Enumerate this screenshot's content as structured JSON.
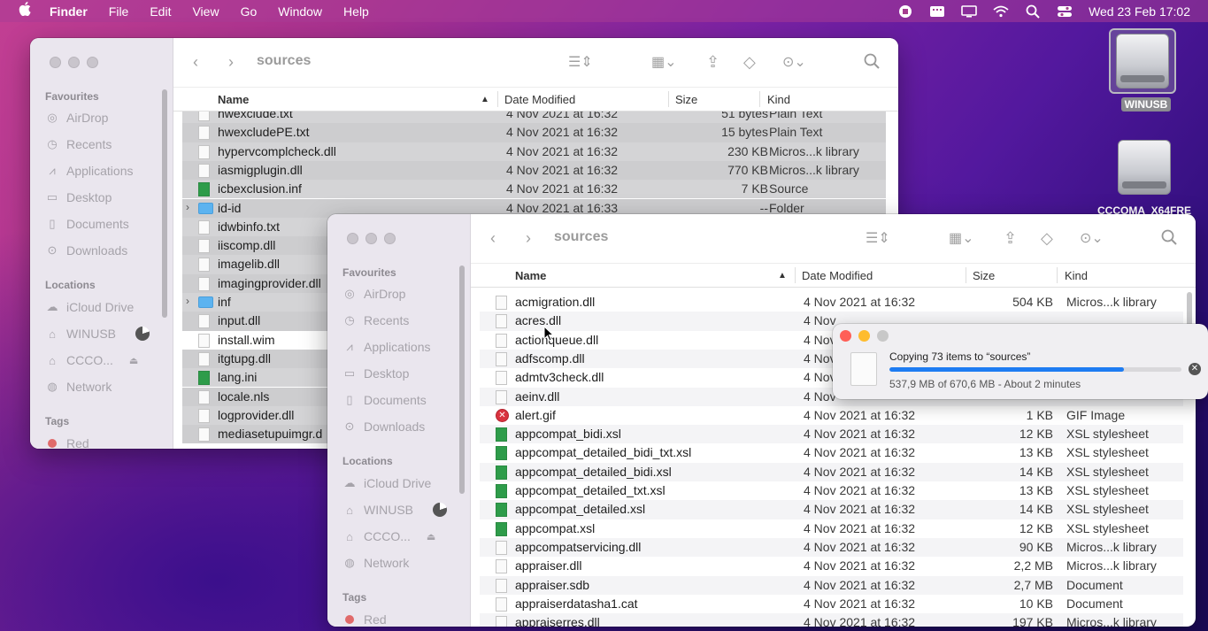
{
  "menubar": {
    "apple": "",
    "menus": [
      "Finder",
      "File",
      "Edit",
      "View",
      "Go",
      "Window",
      "Help"
    ],
    "clock": "Wed 23 Feb  17:02"
  },
  "desktop": {
    "drives": [
      {
        "label": "WINUSB",
        "selected": true
      },
      {
        "label": "CCCOMA_X64FRE",
        "selected": false
      }
    ]
  },
  "back_window": {
    "title": "sources",
    "sidebar": {
      "favourites_header": "Favourites",
      "favourites": [
        "AirDrop",
        "Recents",
        "Applications",
        "Desktop",
        "Documents",
        "Downloads"
      ],
      "locations_header": "Locations",
      "locations": [
        "iCloud Drive",
        "WINUSB",
        "CCCO...",
        "Network"
      ],
      "tags_header": "Tags",
      "tags": [
        "Red"
      ]
    },
    "columns": {
      "name": "Name",
      "date": "Date Modified",
      "size": "Size",
      "kind": "Kind"
    },
    "rows": [
      {
        "name": "hwexclude.txt",
        "date": "4 Nov 2021 at 16:32",
        "size": "51 bytes",
        "kind": "Plain Text"
      },
      {
        "name": "hwexcludePE.txt",
        "date": "4 Nov 2021 at 16:32",
        "size": "15 bytes",
        "kind": "Plain Text"
      },
      {
        "name": "hypervcomplcheck.dll",
        "date": "4 Nov 2021 at 16:32",
        "size": "230 KB",
        "kind": "Micros...k library"
      },
      {
        "name": "iasmigplugin.dll",
        "date": "4 Nov 2021 at 16:32",
        "size": "770 KB",
        "kind": "Micros...k library"
      },
      {
        "name": "icbexclusion.inf",
        "date": "4 Nov 2021 at 16:32",
        "size": "7 KB",
        "kind": "Source"
      },
      {
        "name": "id-id",
        "date": "4 Nov 2021 at 16:33",
        "size": "--",
        "kind": "Folder"
      },
      {
        "name": "idwbinfo.txt",
        "date": "",
        "size": "",
        "kind": ""
      },
      {
        "name": "iiscomp.dll",
        "date": "",
        "size": "",
        "kind": ""
      },
      {
        "name": "imagelib.dll",
        "date": "",
        "size": "",
        "kind": ""
      },
      {
        "name": "imagingprovider.dll",
        "date": "",
        "size": "",
        "kind": ""
      },
      {
        "name": "inf",
        "date": "",
        "size": "",
        "kind": ""
      },
      {
        "name": "input.dll",
        "date": "",
        "size": "",
        "kind": ""
      },
      {
        "name": "install.wim",
        "date": "",
        "size": "",
        "kind": ""
      },
      {
        "name": "itgtupg.dll",
        "date": "",
        "size": "",
        "kind": ""
      },
      {
        "name": "lang.ini",
        "date": "",
        "size": "",
        "kind": ""
      },
      {
        "name": "locale.nls",
        "date": "",
        "size": "",
        "kind": ""
      },
      {
        "name": "logprovider.dll",
        "date": "",
        "size": "",
        "kind": ""
      },
      {
        "name": "mediasetupuimgr.d",
        "date": "",
        "size": "",
        "kind": ""
      }
    ]
  },
  "front_window": {
    "title": "sources",
    "sidebar": {
      "favourites_header": "Favourites",
      "favourites": [
        "AirDrop",
        "Recents",
        "Applications",
        "Desktop",
        "Documents",
        "Downloads"
      ],
      "locations_header": "Locations",
      "locations": [
        "iCloud Drive",
        "WINUSB",
        "CCCO...",
        "Network"
      ],
      "tags_header": "Tags",
      "tags": [
        "Red"
      ]
    },
    "columns": {
      "name": "Name",
      "date": "Date Modified",
      "size": "Size",
      "kind": "Kind"
    },
    "rows": [
      {
        "name": "acmigration.dll",
        "date": "4 Nov 2021 at 16:32",
        "size": "504 KB",
        "kind": "Micros...k library"
      },
      {
        "name": "acres.dll",
        "date": "4 Nov",
        "size": "",
        "kind": ""
      },
      {
        "name": "actionqueue.dll",
        "date": "4 Nov",
        "size": "",
        "kind": ""
      },
      {
        "name": "adfscomp.dll",
        "date": "4 Nov",
        "size": "",
        "kind": ""
      },
      {
        "name": "admtv3check.dll",
        "date": "4 Nov",
        "size": "",
        "kind": ""
      },
      {
        "name": "aeinv.dll",
        "date": "4 Nov",
        "size": "",
        "kind": ""
      },
      {
        "name": "alert.gif",
        "date": "4 Nov 2021 at 16:32",
        "size": "1 KB",
        "kind": "GIF Image"
      },
      {
        "name": "appcompat_bidi.xsl",
        "date": "4 Nov 2021 at 16:32",
        "size": "12 KB",
        "kind": "XSL stylesheet"
      },
      {
        "name": "appcompat_detailed_bidi_txt.xsl",
        "date": "4 Nov 2021 at 16:32",
        "size": "13 KB",
        "kind": "XSL stylesheet"
      },
      {
        "name": "appcompat_detailed_bidi.xsl",
        "date": "4 Nov 2021 at 16:32",
        "size": "14 KB",
        "kind": "XSL stylesheet"
      },
      {
        "name": "appcompat_detailed_txt.xsl",
        "date": "4 Nov 2021 at 16:32",
        "size": "13 KB",
        "kind": "XSL stylesheet"
      },
      {
        "name": "appcompat_detailed.xsl",
        "date": "4 Nov 2021 at 16:32",
        "size": "14 KB",
        "kind": "XSL stylesheet"
      },
      {
        "name": "appcompat.xsl",
        "date": "4 Nov 2021 at 16:32",
        "size": "12 KB",
        "kind": "XSL stylesheet"
      },
      {
        "name": "appcompatservicing.dll",
        "date": "4 Nov 2021 at 16:32",
        "size": "90 KB",
        "kind": "Micros...k library"
      },
      {
        "name": "appraiser.dll",
        "date": "4 Nov 2021 at 16:32",
        "size": "2,2 MB",
        "kind": "Micros...k library"
      },
      {
        "name": "appraiser.sdb",
        "date": "4 Nov 2021 at 16:32",
        "size": "2,7 MB",
        "kind": "Document"
      },
      {
        "name": "appraiserdatasha1.cat",
        "date": "4 Nov 2021 at 16:32",
        "size": "10 KB",
        "kind": "Document"
      },
      {
        "name": "appraiserres.dll",
        "date": "4 Nov 2021 at 16:32",
        "size": "197 KB",
        "kind": "Micros...k library"
      }
    ]
  },
  "progress_dialog": {
    "title": "Copying 73 items to “sources”",
    "subtitle": "537,9 MB of 670,6 MB - About 2 minutes",
    "fraction": 0.802
  },
  "colors": {
    "accent": "#1e7cf2",
    "close": "#ff5f57",
    "minimize": "#febc2e",
    "zoom": "#c8c8c8"
  }
}
